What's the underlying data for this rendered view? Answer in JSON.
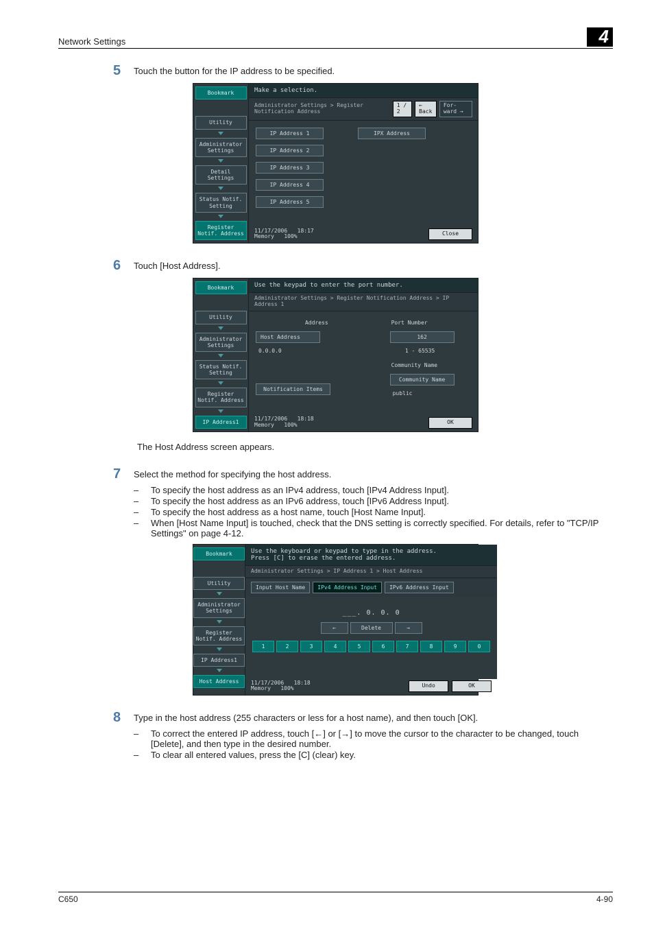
{
  "header": {
    "title": "Network Settings",
    "chapter": "4"
  },
  "steps": {
    "s5": {
      "num": "5",
      "text": "Touch the button for the IP address to be specified."
    },
    "s6": {
      "num": "6",
      "text": "Touch [Host Address]."
    },
    "s6_after": "The Host Address screen appears.",
    "s7": {
      "num": "7",
      "text": "Select the method for specifying the host address.",
      "bullets": [
        "To specify the host address as an IPv4 address, touch [IPv4 Address Input].",
        "To specify the host address as an IPv6 address, touch [IPv6 Address Input].",
        "To specify the host address as a host name, touch [Host Name Input].",
        "When [Host Name Input] is touched, check that the DNS setting is correctly specified. For details, refer to \"TCP/IP Settings\" on page 4-12."
      ]
    },
    "s8": {
      "num": "8",
      "text": "Type in the host address (255 characters or less for a host name), and then touch [OK].",
      "bullets": [
        "To correct the entered IP address, touch [←] or [→] to move the cursor to the character to be changed, touch [Delete], and then type in the desired number.",
        "To clear all entered values, press the [C] (clear) key."
      ]
    }
  },
  "panel_common": {
    "bookmark": "Bookmark",
    "utility": "Utility",
    "admin": "Administrator Settings",
    "detail": "Detail Settings",
    "status_notif": "Status Notif. Setting",
    "reg_notif": "Register Notif. Address",
    "ip_addr1": "IP Address1",
    "host_addr": "Host Address",
    "date": "11/17/2006",
    "memory_label": "Memory",
    "memory_val": "100%"
  },
  "panel1": {
    "hdr": "Make a selection.",
    "crumbs": "Administrator Settings > Register Notification Address",
    "page": "1 / 2",
    "back": "← Back",
    "forward": "For- ward →",
    "ip_buttons": [
      "IP Address 1",
      "IP Address 2",
      "IP Address 3",
      "IP Address 4",
      "IP Address 5"
    ],
    "ipx": "IPX Address",
    "time": "18:17",
    "close": "Close"
  },
  "panel2": {
    "hdr": "Use the keypad to enter the port number.",
    "crumbs": "Administrator Settings > Register Notification Address > IP Address 1",
    "addr_label": "Address",
    "host_btn": "Host Address",
    "host_val": "0.0.0.0",
    "notif_items": "Notification Items",
    "port_label": "Port Number",
    "port_val": "162",
    "port_range": "1  -  65535",
    "comm_label": "Community Name",
    "comm_btn": "Community Name",
    "comm_val": "public",
    "time": "18:18",
    "ok": "OK"
  },
  "panel3": {
    "hdr_l1": "Use the keyboard or keypad to type in the address.",
    "hdr_l2": "Press [C] to erase the entered address.",
    "crumbs": "Administrator Settings > IP Address 1 > Host Address",
    "tabs": {
      "host": "Input Host Name",
      "ipv4": "IPv4 Address Input",
      "ipv6": "IPv6 Address Input"
    },
    "entry": "___.  0.  0.  0",
    "nav": {
      "left": "←",
      "delete": "Delete",
      "right": "→"
    },
    "keypad": [
      "1",
      "2",
      "3",
      "4",
      "5",
      "6",
      "7",
      "8",
      "9",
      "0"
    ],
    "time": "18:18",
    "undo": "Undo",
    "ok": "OK"
  },
  "footer": {
    "model": "C650",
    "page": "4-90"
  }
}
